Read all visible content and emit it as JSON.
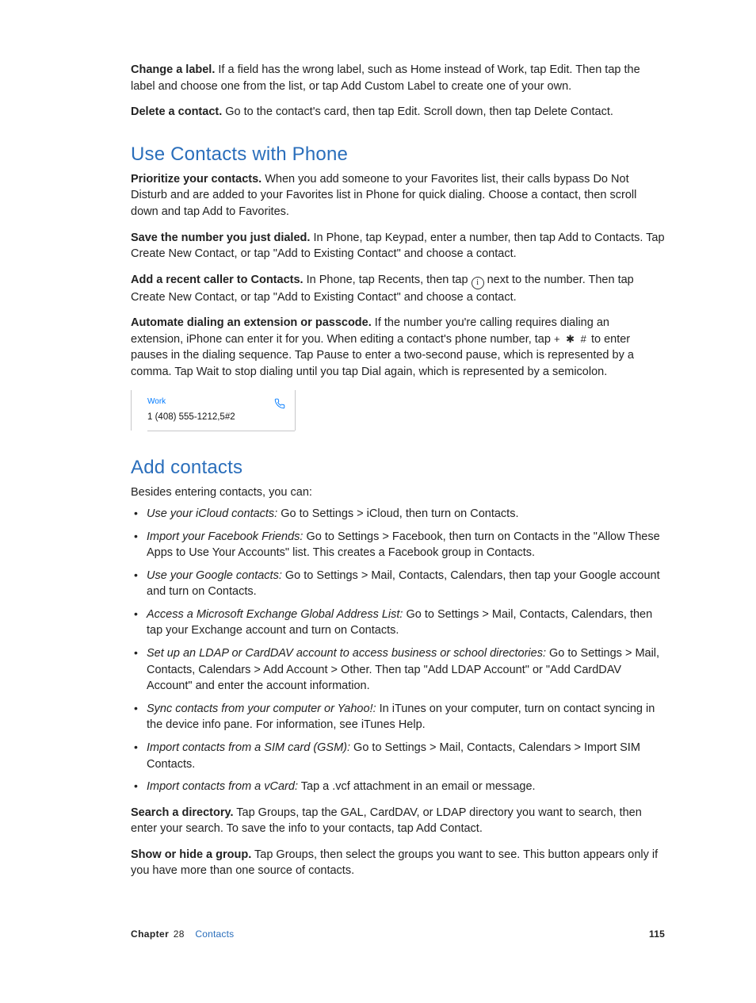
{
  "top": {
    "p1_lead": "Change a label.",
    "p1_rest": " If a field has the wrong label, such as Home instead of Work, tap Edit. Then tap the label and choose one from the list, or tap Add Custom Label to create one of your own.",
    "p2_lead": "Delete a contact.",
    "p2_rest": " Go to the contact's card, then tap Edit. Scroll down, then tap Delete Contact."
  },
  "sec1": {
    "heading": "Use Contacts with Phone",
    "p1_lead": "Prioritize your contacts.",
    "p1_rest": " When you add someone to your Favorites list, their calls bypass Do Not Disturb and are added to your Favorites list in Phone for quick dialing. Choose a contact, then scroll down and tap Add to Favorites.",
    "p2_lead": "Save the number you just dialed.",
    "p2_rest": " In Phone, tap Keypad, enter a number, then tap Add to Contacts. Tap Create New Contact, or tap \"Add to Existing Contact\" and choose a contact.",
    "p3_lead": "Add a recent caller to Contacts.",
    "p3_before": " In Phone, tap Recents, then tap ",
    "info_glyph": "i",
    "p3_after": " next to the number. Then tap Create New Contact, or tap \"Add to Existing Contact\" and choose a contact.",
    "p4_lead": "Automate dialing an extension or passcode.",
    "p4_before": " If the number you're calling requires dialing an extension, iPhone can enter it for you. When editing a contact's phone number, tap ",
    "keypad_symbols": "+ ✱ #",
    "p4_after": " to enter pauses in the dialing sequence. Tap Pause to enter a two-second pause, which is represented by a comma. Tap Wait to stop dialing until you tap Dial again, which is represented by a semicolon."
  },
  "card": {
    "label": "Work",
    "number": "1 (408) 555-1212,5#2"
  },
  "sec2": {
    "heading": "Add contacts",
    "intro": "Besides entering contacts, you can:",
    "items": [
      {
        "em": "Use your iCloud contacts:",
        "rest": "  Go to Settings > iCloud, then turn on Contacts."
      },
      {
        "em": "Import your Facebook Friends:",
        "rest": "  Go to Settings > Facebook, then turn on Contacts in the \"Allow These Apps to Use Your Accounts\" list. This creates a Facebook group in Contacts."
      },
      {
        "em": "Use your Google contacts:",
        "rest": "  Go to Settings > Mail, Contacts, Calendars, then tap your Google account and turn on Contacts."
      },
      {
        "em": "Access a Microsoft Exchange Global Address List:",
        "rest": "  Go to Settings > Mail, Contacts, Calendars, then tap your Exchange account and turn on Contacts."
      },
      {
        "em": "Set up an LDAP or CardDAV account to access business or school directories:",
        "rest": "  Go to Settings > Mail, Contacts, Calendars > Add Account > Other. Then tap \"Add LDAP Account\" or \"Add CardDAV Account\" and enter the account information."
      },
      {
        "em": "Sync contacts from your computer or Yahoo!:",
        "rest": "  In iTunes on your computer, turn on contact syncing in the device info pane. For information, see iTunes Help."
      },
      {
        "em": "Import contacts from a SIM card (GSM):",
        "rest": "  Go to Settings > Mail, Contacts, Calendars > Import SIM Contacts."
      },
      {
        "em": "Import contacts from a vCard:",
        "rest": "  Tap a .vcf attachment in an email or message."
      }
    ],
    "p_search_lead": "Search a directory.",
    "p_search_rest": " Tap Groups, tap the GAL, CardDAV, or LDAP directory you want to search, then enter your search. To save the info to your contacts, tap Add Contact.",
    "p_group_lead": "Show or hide a group.",
    "p_group_rest": " Tap Groups, then select the groups you want to see. This button appears only if you have more than one source of contacts."
  },
  "footer": {
    "chapter_word": "Chapter",
    "chapter_num": "28",
    "chapter_name": "Contacts",
    "page_num": "115"
  }
}
